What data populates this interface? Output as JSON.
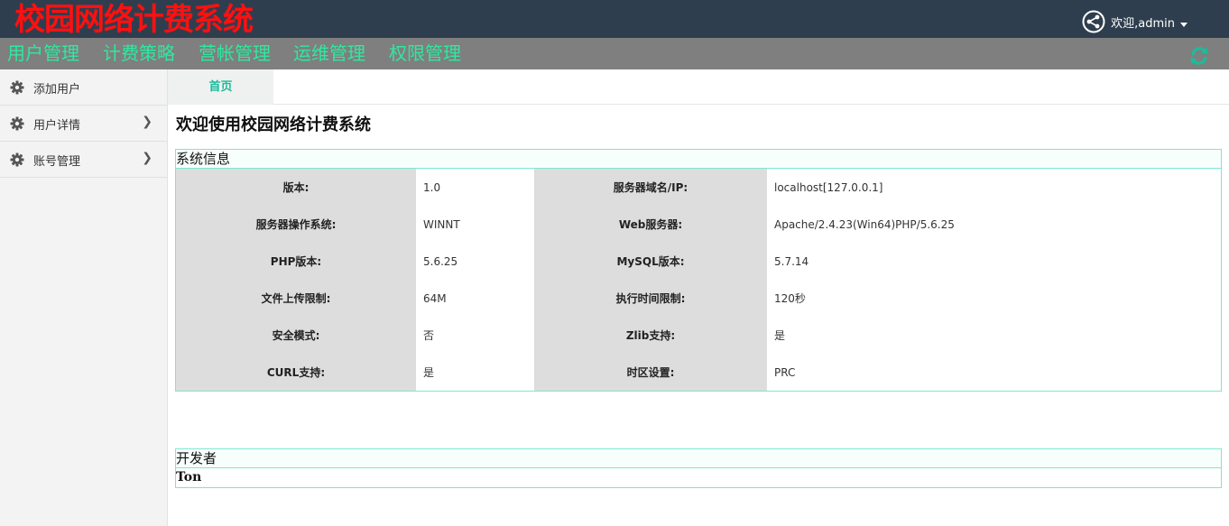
{
  "header": {
    "app_title": "校园网络计费系统",
    "user_label": "欢迎,admin"
  },
  "nav": {
    "items": [
      {
        "label": "用户管理"
      },
      {
        "label": "计费策略"
      },
      {
        "label": "营帐管理"
      },
      {
        "label": "运维管理"
      },
      {
        "label": "权限管理"
      }
    ]
  },
  "sidebar": {
    "items": [
      {
        "label": "添加用户"
      },
      {
        "label": "用户详情"
      },
      {
        "label": "账号管理"
      }
    ]
  },
  "tabs": {
    "home": "首页"
  },
  "main": {
    "welcome": "欢迎使用校园网络计费系统",
    "sysinfo_title": "系统信息",
    "rows": [
      {
        "k1": "版本:",
        "v1": "1.0",
        "k2": "服务器域名/IP:",
        "v2": "localhost[127.0.0.1]"
      },
      {
        "k1": "服务器操作系统:",
        "v1": "WINNT",
        "k2": "Web服务器:",
        "v2": "Apache/2.4.23(Win64)PHP/5.6.25"
      },
      {
        "k1": "PHP版本:",
        "v1": "5.6.25",
        "k2": "MySQL版本:",
        "v2": "5.7.14"
      },
      {
        "k1": "文件上传限制:",
        "v1": "64M",
        "k2": "执行时间限制:",
        "v2": "120秒"
      },
      {
        "k1": "安全模式:",
        "v1": "否",
        "k2": "Zlib支持:",
        "v2": "是"
      },
      {
        "k1": "CURL支持:",
        "v1": "是",
        "k2": "时区设置:",
        "v2": "PRC"
      }
    ],
    "developer_title": "开发者",
    "developer_name": "Ton"
  },
  "colors": {
    "topbar": "#2f3e4e",
    "title": "#ff1010",
    "nav_text": "#2fe8a0",
    "accent": "#1bbc9b",
    "panel_border": "#7de8cf"
  }
}
